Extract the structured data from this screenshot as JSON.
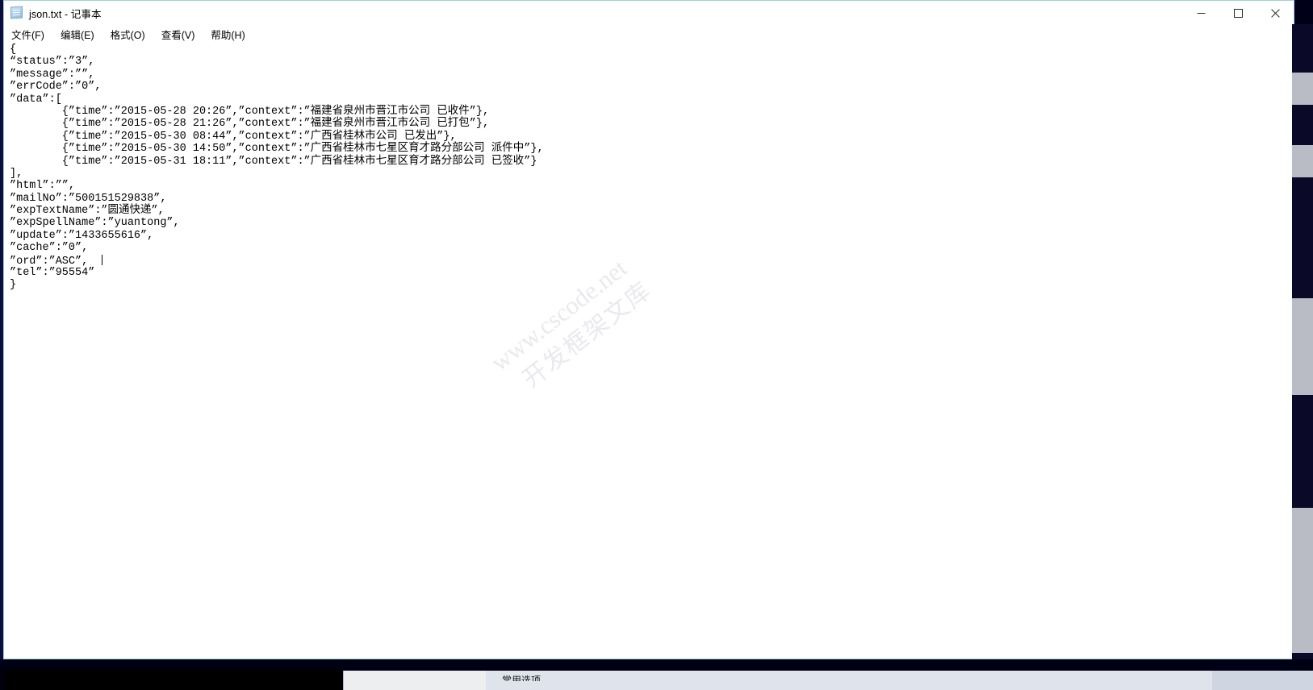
{
  "window": {
    "title": "json.txt - 记事本",
    "icon": "notepad-icon",
    "controls": {
      "minimize": "—",
      "maximize": "□",
      "close": "✕"
    }
  },
  "menubar": {
    "items": [
      {
        "label": "文件(F)",
        "text": "文件",
        "accel": "F"
      },
      {
        "label": "编辑(E)",
        "text": "编辑",
        "accel": "E"
      },
      {
        "label": "格式(O)",
        "text": "格式",
        "accel": "O"
      },
      {
        "label": "查看(V)",
        "text": "查看",
        "accel": "V"
      },
      {
        "label": "帮助(H)",
        "text": "帮助",
        "accel": "H"
      }
    ]
  },
  "editor": {
    "filename": "json.txt",
    "lines": [
      "{",
      "“status”:”3”,",
      "”message”:””,",
      "”errCode”:”0”,",
      "”data”:[",
      "        {”time”:”2015-05-28 20:26”,”context”:”福建省泉州市晋江市公司 已收件”},",
      "        {”time”:”2015-05-28 21:26”,”context”:”福建省泉州市晋江市公司 已打包”},",
      "        {”time”:”2015-05-30 08:44”,”context”:”广西省桂林市公司 已发出”},",
      "        {”time”:”2015-05-30 14:50”,”context”:”广西省桂林市七星区育才路分部公司 派件中”},",
      "        {”time”:”2015-05-31 18:11”,”context”:”广西省桂林市七星区育才路分部公司 已签收”}",
      "],",
      "”html”:””,",
      "”mailNo”:”500151529838”,",
      "”expTextName”:”圆通快递”,",
      "”expSpellName”:”yuantong”,",
      "”update”:”1433655616”,",
      "”cache”:”0”,",
      "”ord”:”ASC”,  ",
      "”tel”:”95554”",
      "}"
    ],
    "caret_line_index": 17,
    "json_fields": {
      "status": "3",
      "message": "",
      "errCode": "0",
      "html": "",
      "mailNo": "500151529838",
      "expTextName": "圆通快递",
      "expSpellName": "yuantong",
      "update": "1433655616",
      "cache": "0",
      "ord": "ASC",
      "tel": "95554"
    },
    "data_entries": [
      {
        "time": "2015-05-28 20:26",
        "context": "福建省泉州市晋江市公司 已收件"
      },
      {
        "time": "2015-05-28 21:26",
        "context": "福建省泉州市晋江市公司 已打包"
      },
      {
        "time": "2015-05-30 08:44",
        "context": "广西省桂林市公司 已发出"
      },
      {
        "time": "2015-05-30 14:50",
        "context": "广西省桂林市七星区育才路分部公司 派件中"
      },
      {
        "time": "2015-05-31 18:11",
        "context": "广西省桂林市七星区育才路分部公司 已签收"
      }
    ]
  },
  "watermark": {
    "line1": "www.cscode.net",
    "line2": "开发框架文库"
  },
  "scrollbar": {
    "up_arrow": "⌃",
    "down_arrow": "⌄"
  },
  "bottom_strip": {
    "label": "常用选项"
  },
  "colors": {
    "window_border": "#9ed0e0",
    "text": "#000000",
    "background": "#ffffff",
    "watermark": "#e9e9ef",
    "desktop": "#000018"
  }
}
